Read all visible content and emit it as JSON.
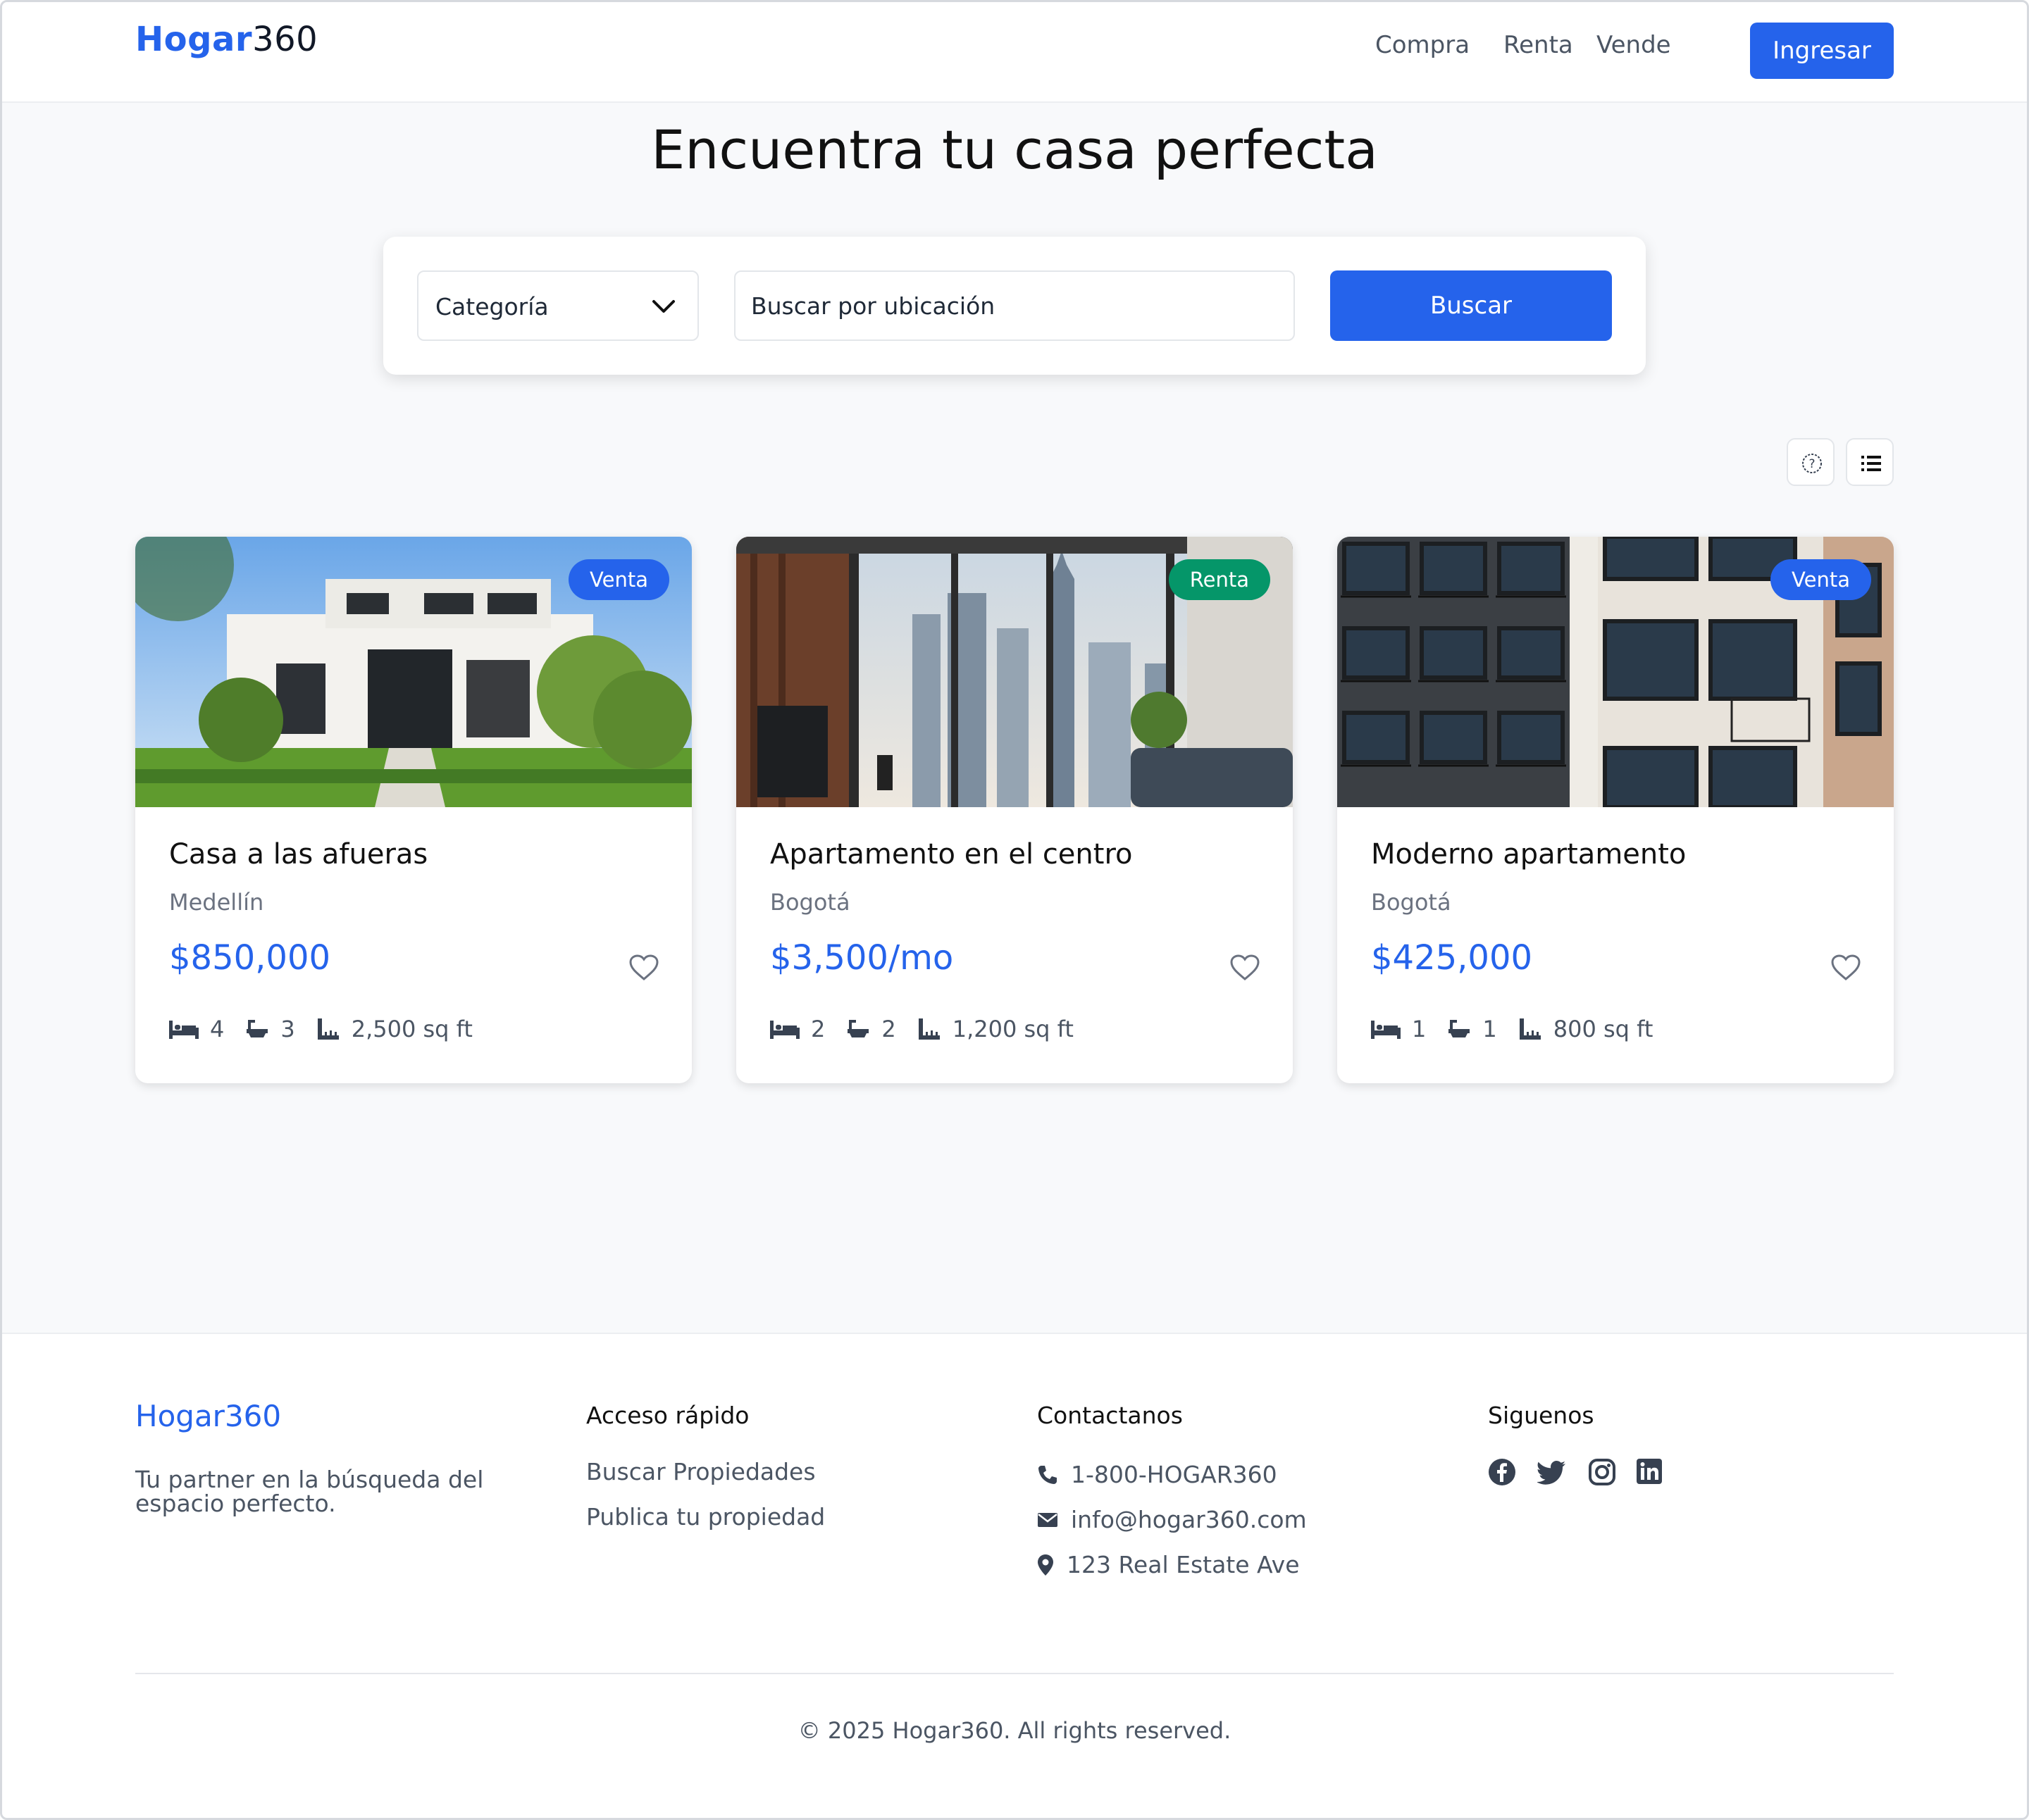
{
  "header": {
    "logo_brand": "Hogar",
    "logo_number": "360",
    "nav": [
      "Compra",
      "Renta",
      "Vende"
    ],
    "login_label": "Ingresar"
  },
  "hero": {
    "title": "Encuentra tu casa perfecta"
  },
  "search": {
    "category_label": "Categoría",
    "location_placeholder": "Buscar por ubicación",
    "button_label": "Buscar"
  },
  "view_toggles": [
    "help-icon",
    "list-icon"
  ],
  "listings": [
    {
      "badge": "Venta",
      "badge_color": "#2563eb",
      "title": "Casa a las afueras",
      "city": "Medellín",
      "price": "$850,000",
      "beds": "4",
      "baths": "3",
      "area": "2,500 sq ft"
    },
    {
      "badge": "Renta",
      "badge_color": "#059669",
      "title": "Apartamento en el centro",
      "city": "Bogotá",
      "price": "$3,500/mo",
      "beds": "2",
      "baths": "2",
      "area": "1,200 sq ft"
    },
    {
      "badge": "Venta",
      "badge_color": "#2563eb",
      "title": "Moderno apartamento",
      "city": "Bogotá",
      "price": "$425,000",
      "beds": "1",
      "baths": "1",
      "area": "800 sq ft"
    }
  ],
  "footer": {
    "brand": "Hogar360",
    "tagline": "Tu partner en la búsqueda del espacio perfecto.",
    "quick_access": {
      "heading": "Acceso rápido",
      "links": [
        "Buscar Propiedades",
        "Publica tu propiedad"
      ]
    },
    "contact": {
      "heading": "Contactanos",
      "phone": "1-800-HOGAR360",
      "email": "info@hogar360.com",
      "address": "123 Real Estate Ave"
    },
    "social": {
      "heading": "Siguenos",
      "icons": [
        "facebook-icon",
        "twitter-icon",
        "instagram-icon",
        "linkedin-icon"
      ]
    },
    "copyright": "© 2025 Hogar360. All rights reserved."
  },
  "colors": {
    "accent": "#2563eb",
    "rent_badge": "#059669",
    "background": "#f8f9fb"
  }
}
